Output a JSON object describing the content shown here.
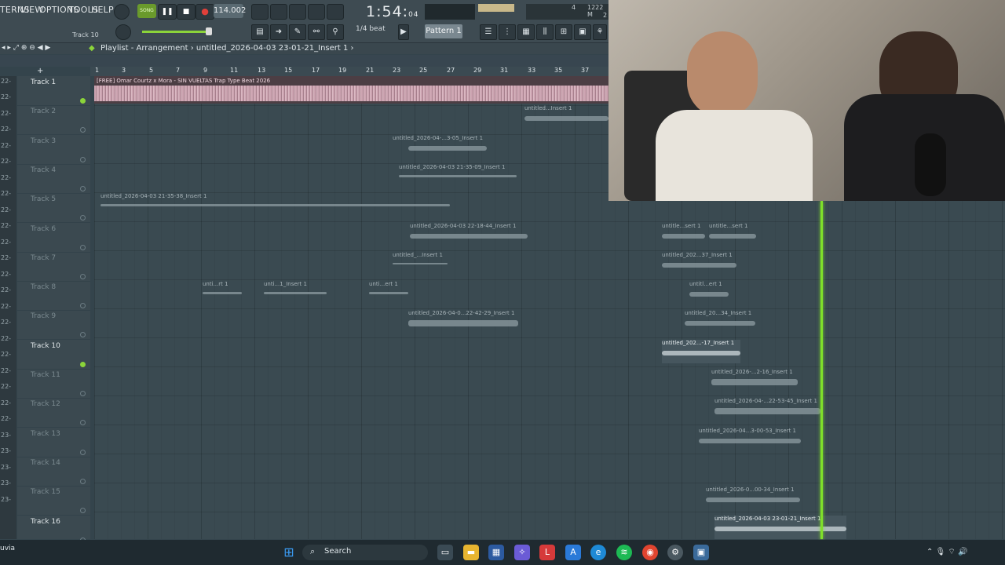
{
  "menu": [
    "TERNS",
    "VIEW",
    "OPTIONS",
    "TOOLS",
    "HELP"
  ],
  "transport": {
    "song_label": "SONG",
    "tempo": "114.002",
    "time": "1:54",
    "time_sub": "04",
    "time_unit": "M:S:CS"
  },
  "cpu": {
    "a": "4",
    "b": "1222 M",
    "c": "2"
  },
  "toolbar": {
    "snap": "1/4 beat",
    "pattern": "Pattern 1",
    "hint_track": "Track 10"
  },
  "playlist": {
    "title": "Playlist - Arrangement",
    "file": "untitled_2026-04-03 23-01-21_Insert 1"
  },
  "ruler": [
    "1",
    "3",
    "5",
    "7",
    "9",
    "11",
    "13",
    "15",
    "17",
    "19",
    "21",
    "23",
    "25",
    "27",
    "29",
    "31",
    "33",
    "35",
    "37"
  ],
  "left_strip": [
    "22-",
    "22-",
    "22-",
    "22-",
    "22-",
    "22-",
    "22-",
    "22-",
    "22-",
    "22-",
    "22-",
    "22-",
    "22-",
    "22-",
    "22-",
    "22-",
    "22-",
    "22-",
    "22-",
    "22-",
    "22-",
    "22-",
    "23-",
    "23-",
    "23-",
    "23-",
    "23-"
  ],
  "tracks": [
    {
      "name": "Track 1",
      "active": true,
      "dot": true
    },
    {
      "name": "Track 2",
      "active": false,
      "dot": false
    },
    {
      "name": "Track 3",
      "active": false,
      "dot": false
    },
    {
      "name": "Track 4",
      "active": false,
      "dot": false
    },
    {
      "name": "Track 5",
      "active": false,
      "dot": false
    },
    {
      "name": "Track 6",
      "active": false,
      "dot": false
    },
    {
      "name": "Track 7",
      "active": false,
      "dot": false
    },
    {
      "name": "Track 8",
      "active": false,
      "dot": false
    },
    {
      "name": "Track 9",
      "active": false,
      "dot": false
    },
    {
      "name": "Track 10",
      "active": true,
      "dot": true
    },
    {
      "name": "Track 11",
      "active": false,
      "dot": false
    },
    {
      "name": "Track 12",
      "active": false,
      "dot": false
    },
    {
      "name": "Track 13",
      "active": false,
      "dot": false
    },
    {
      "name": "Track 14",
      "active": false,
      "dot": false
    },
    {
      "name": "Track 15",
      "active": false,
      "dot": false
    },
    {
      "name": "Track 16",
      "active": true,
      "dot": false
    }
  ],
  "beat_clip": "[FREE] Omar Courtz x Mora - SIN VUELTAS Trap Type Beat 2026",
  "clips": [
    "untitled...Insert 1",
    "untitled_2026-04-...3-05_Insert 1",
    "untitled_2026-04-03 21-35-09_Insert 1",
    "untitled_2026-04-03 21-35-38_Insert 1",
    "untitled_2026-04-03 22-18-44_Insert 1",
    "untitle...sert 1",
    "untitle...sert 1",
    "untitled_...Insert 1",
    "untitled_202...37_Insert 1",
    "unti...rt 1",
    "unti...1_Insert 1",
    "unti...ert 1",
    "untitl...ert 1",
    "untitled_2026-04-0...22-42-29_Insert 1",
    "untitled_20...34_Insert 1",
    "untitled_202...-17_Insert 1",
    "untitled_2026-...2-16_Insert 1",
    "untitled_2026-04-...22-53-45_Insert 1",
    "untitled_2026-04...3-00-53_Insert 1",
    "untitled_2026-0...00-34_Insert 1",
    "untitled_2026-04-03 23-01-21_Insert 1"
  ],
  "taskbar": {
    "search": "Search",
    "left_text": "uvia"
  }
}
